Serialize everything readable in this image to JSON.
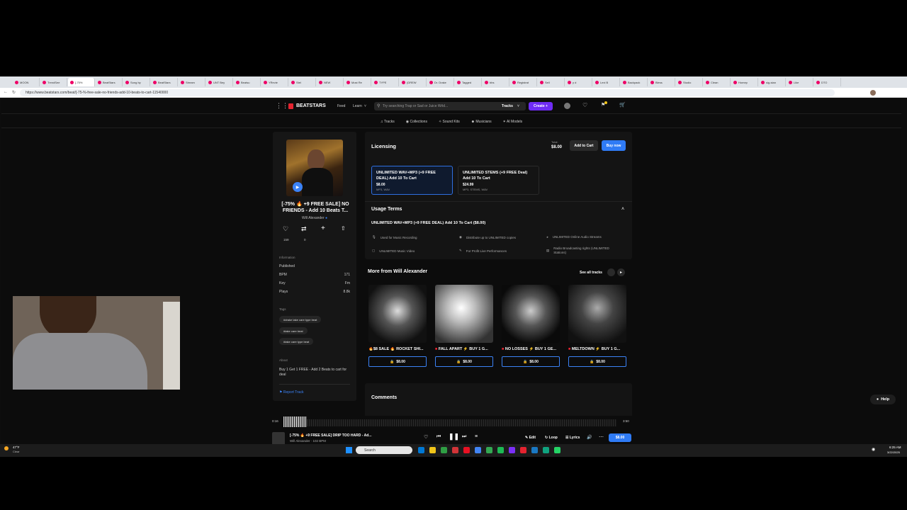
{
  "browser": {
    "tabs": [
      "MOON",
      "TrendSee",
      "[-75%",
      "BeatStars",
      "Song by",
      "BeatStars",
      "Stream",
      "UNT Bey",
      "Beatsu",
      "YRevie",
      "Stel",
      "NEW",
      "Most Re",
      "TYPE",
      "(DREW",
      "Dr. Drake",
      "Tagged",
      "bbs",
      "Registrat",
      "Sell",
      "y d",
      "Lexi B",
      "Backpack",
      "Bless",
      "Studio",
      "Clean",
      "Homep",
      "sig-stan",
      "Like",
      "DTO"
    ],
    "active_tab_index": 2,
    "url": "https://www.beatstars.com/beat/[-75-%-free-sale-no-friends-add-10-beats-to-cart-11540000"
  },
  "header": {
    "brand": "BEATSTARS",
    "feed": "Feed",
    "learn": "Learn",
    "search_placeholder": "Try searching Trap or Sad or Juice Wrld...",
    "search_scope": "Tracks",
    "create": "Create"
  },
  "subnav": [
    "Tracks",
    "Collections",
    "Sound Kits",
    "Musicians",
    "AI Models"
  ],
  "beat": {
    "title": "[-75% 🔥 +9 FREE SALE] NO FRIENDS - Add 10 Beats T...",
    "artist": "Will Alexander",
    "likes": "159",
    "reposts": "0",
    "info_heading": "Information",
    "info": [
      {
        "label": "Published",
        "value": ""
      },
      {
        "label": "BPM",
        "value": "171"
      },
      {
        "label": "Key",
        "value": "Fm"
      },
      {
        "label": "Plays",
        "value": "8.8k"
      }
    ],
    "tags_heading": "Tags",
    "tags": [
      "#drake take care type beat",
      "#take care beat",
      "#take care type beat"
    ],
    "about_heading": "About",
    "about": "Buy 1 Get 1 FREE - Add 2 Beats to cart for deal",
    "report": "Report Track"
  },
  "licensing": {
    "heading": "Licensing",
    "total_label": "Total:",
    "total": "$8.00",
    "add_to_cart": "Add to Cart",
    "buy_now": "Buy now",
    "options": [
      {
        "name": "UNLIMITED WAV+MP3 (+9 FREE DEAL) Add 10 To Cart",
        "price": "$8.00",
        "formats": "MP3, WAV",
        "selected": true
      },
      {
        "name": "UNLIMITED STEMS (+9 FREE Deal) Add 10 To Cart",
        "price": "$24.99",
        "formats": "MP3, STEMS, WAV",
        "selected": false
      }
    ],
    "usage_heading": "Usage Terms",
    "usage_title": "UNLIMITED WAV+MP3 (+9 FREE DEAL) Add 10 To Cart ($8.00)",
    "usage_terms": [
      "Used for Music Recording",
      "Distribute up to UNLIMITED copies",
      "UNLIMITED Online Audio Streams",
      "UNLIMITED Music Video",
      "For Profit Live Performances",
      "Radio Broadcasting rights (UNLIMITED Stations)"
    ]
  },
  "more": {
    "heading": "More from Will Alexander",
    "see_all": "See all tracks",
    "tracks": [
      {
        "title": "🔥$8 SALE 🔥 ROCKET SHI...",
        "price": "$8.00"
      },
      {
        "title": "FALL APART ⚡ BUY 1 G...",
        "price": "$8.00"
      },
      {
        "title": "NO LOSSES ⚡ BUY 1 GE...",
        "price": "$8.00"
      },
      {
        "title": "MELTDOWN ⚡ BUY 1 G...",
        "price": "$8.00"
      }
    ]
  },
  "comments_heading": "Comments",
  "help": "Help",
  "player": {
    "elapsed": "0:16",
    "duration": "3:50",
    "progress": 0.07,
    "track": "[-75% 🔥 +9 FREE SALE] DRIP TOO HARD - Ad...",
    "artist_line": "Will Alexander · 102 BPM",
    "edit": "Edit",
    "loop": "Loop",
    "lyrics": "Lyrics",
    "price": "$8.00"
  },
  "taskbar": {
    "weather_temp": "47°F",
    "weather_desc": "Clear",
    "search": "Search",
    "time": "6:25 AM",
    "date": "3/22/2025"
  },
  "colors": {
    "accent_blue": "#3b82f6",
    "create_purple": "#6f2cf5",
    "brand_red": "#e5232f"
  }
}
